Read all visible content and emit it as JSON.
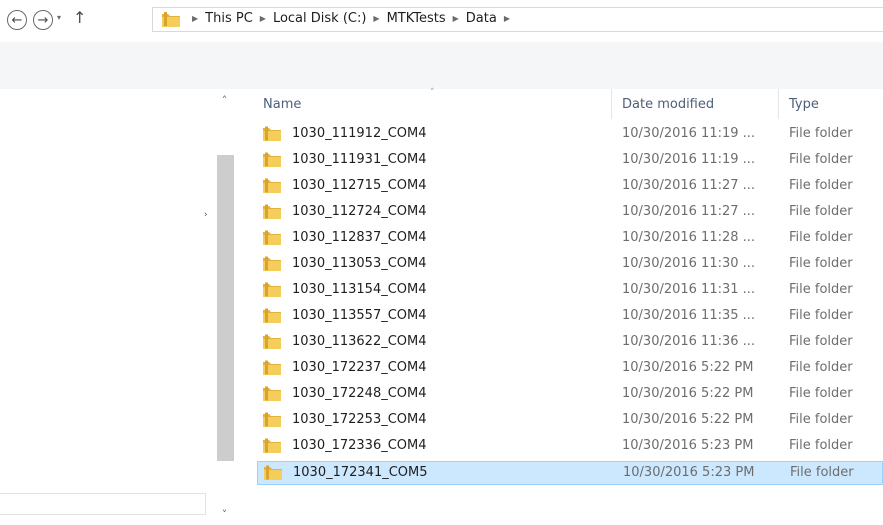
{
  "address_bar": {
    "back_glyph": "←",
    "forward_glyph": "→",
    "recent_glyph": "▾",
    "up_glyph": "↑",
    "crumb_arrow": "▶",
    "breadcrumbs": [
      "This PC",
      "Local Disk (C:)",
      "MTKTests",
      "Data"
    ]
  },
  "nav_pane": {
    "expander_glyph": "›"
  },
  "scrollbar": {
    "up_glyph": "˄",
    "down_glyph": "˅"
  },
  "columns": {
    "name": "Name",
    "date": "Date modified",
    "type": "Type",
    "sort_glyph": "˄"
  },
  "files": [
    {
      "name": "1030_111912_COM4",
      "date": "10/30/2016 11:19 ...",
      "type": "File folder"
    },
    {
      "name": "1030_111931_COM4",
      "date": "10/30/2016 11:19 ...",
      "type": "File folder"
    },
    {
      "name": "1030_112715_COM4",
      "date": "10/30/2016 11:27 ...",
      "type": "File folder"
    },
    {
      "name": "1030_112724_COM4",
      "date": "10/30/2016 11:27 ...",
      "type": "File folder"
    },
    {
      "name": "1030_112837_COM4",
      "date": "10/30/2016 11:28 ...",
      "type": "File folder"
    },
    {
      "name": "1030_113053_COM4",
      "date": "10/30/2016 11:30 ...",
      "type": "File folder"
    },
    {
      "name": "1030_113154_COM4",
      "date": "10/30/2016 11:31 ...",
      "type": "File folder"
    },
    {
      "name": "1030_113557_COM4",
      "date": "10/30/2016 11:35 ...",
      "type": "File folder"
    },
    {
      "name": "1030_113622_COM4",
      "date": "10/30/2016 11:36 ...",
      "type": "File folder"
    },
    {
      "name": "1030_172237_COM4",
      "date": "10/30/2016 5:22 PM",
      "type": "File folder"
    },
    {
      "name": "1030_172248_COM4",
      "date": "10/30/2016 5:22 PM",
      "type": "File folder"
    },
    {
      "name": "1030_172253_COM4",
      "date": "10/30/2016 5:22 PM",
      "type": "File folder"
    },
    {
      "name": "1030_172336_COM4",
      "date": "10/30/2016 5:23 PM",
      "type": "File folder"
    },
    {
      "name": "1030_172341_COM5",
      "date": "10/30/2016 5:23 PM",
      "type": "File folder",
      "selected": true
    }
  ],
  "colors": {
    "selection_bg": "#cce8ff",
    "selection_border": "#99d1ff",
    "header_text": "#4c607a",
    "folder_yellow": "#f0c24a"
  }
}
